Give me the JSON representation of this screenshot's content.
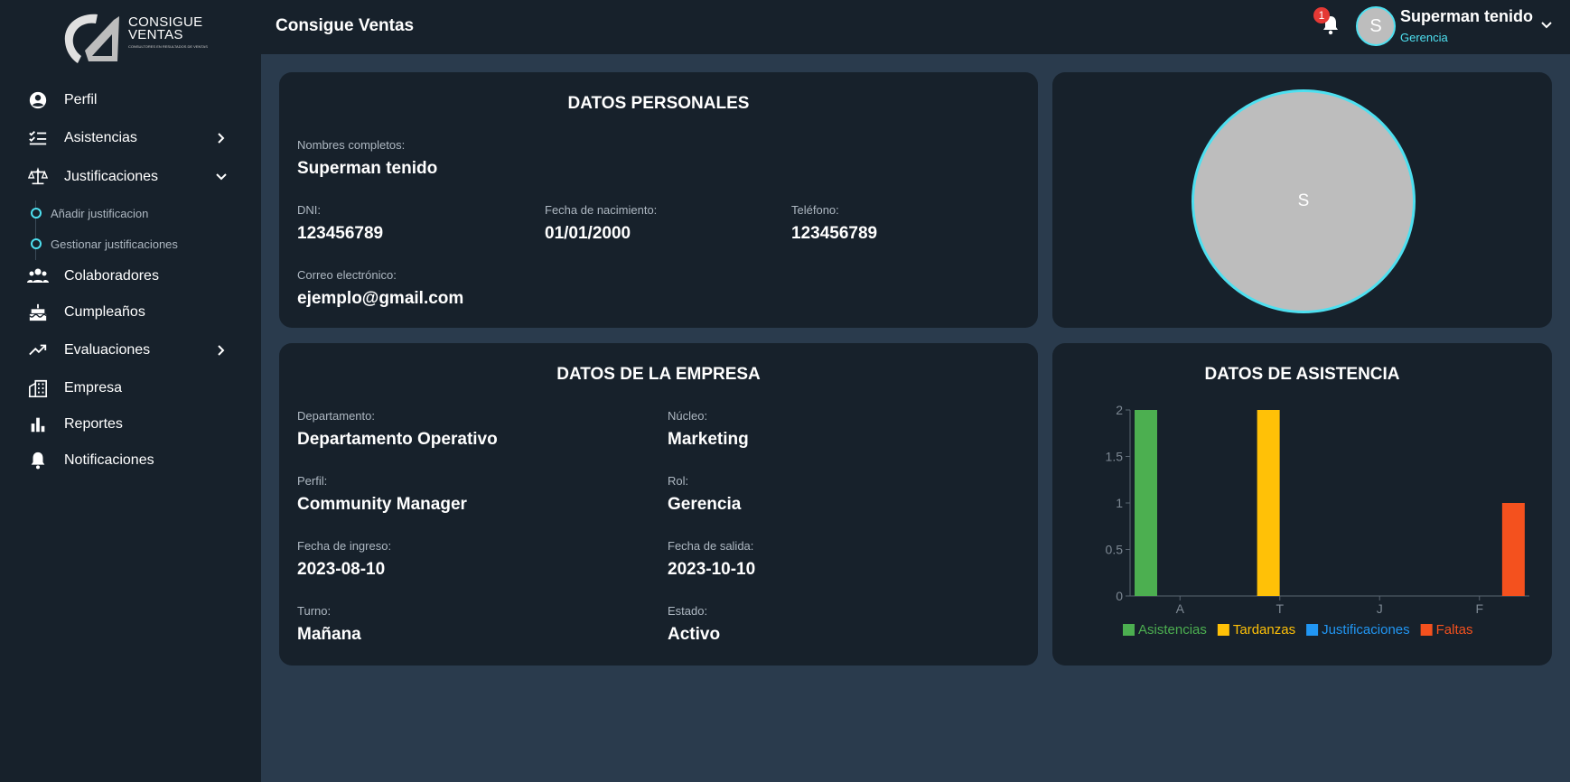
{
  "brand": {
    "logo_line1": "CONSIGUE",
    "logo_line2": "VENTAS",
    "logo_sub": "CONSULTORES EN RESULTADOS DE VENTAS"
  },
  "app_title": "Consigue Ventas",
  "notifications": {
    "count": "1"
  },
  "user": {
    "initial": "S",
    "name": "Superman tenido",
    "role": "Gerencia"
  },
  "sidebar": {
    "items": [
      {
        "label": "Perfil",
        "icon": "user-circle-icon"
      },
      {
        "label": "Asistencias",
        "icon": "checklist-icon"
      },
      {
        "label": "Justificaciones",
        "icon": "scale-icon"
      },
      {
        "label": "Colaboradores",
        "icon": "people-icon"
      },
      {
        "label": "Cumpleaños",
        "icon": "cake-icon"
      },
      {
        "label": "Evaluaciones",
        "icon": "trending-up-icon"
      },
      {
        "label": "Empresa",
        "icon": "building-icon"
      },
      {
        "label": "Reportes",
        "icon": "bar-chart-icon"
      },
      {
        "label": "Notificaciones",
        "icon": "bell-icon"
      }
    ],
    "sub_items": [
      {
        "label": "Añadir justificacion"
      },
      {
        "label": "Gestionar justificaciones"
      }
    ]
  },
  "personal": {
    "title": "DATOS PERSONALES",
    "fullname_label": "Nombres completos:",
    "fullname": "Superman tenido",
    "dni_label": "DNI:",
    "dni": "123456789",
    "birth_label": "Fecha de nacimiento:",
    "birth": "01/01/2000",
    "phone_label": "Teléfono:",
    "phone": "123456789",
    "email_label": "Correo electrónico:",
    "email": "ejemplo@gmail.com"
  },
  "profile_photo": {
    "initial": "S"
  },
  "company": {
    "title": "DATOS DE LA EMPRESA",
    "dept_label": "Departamento:",
    "dept": "Departamento Operativo",
    "nucleo_label": "Núcleo:",
    "nucleo": "Marketing",
    "perfil_label": "Perfil:",
    "perfil": "Community Manager",
    "rol_label": "Rol:",
    "rol": "Gerencia",
    "ingreso_label": "Fecha de ingreso:",
    "ingreso": "2023-08-10",
    "salida_label": "Fecha de salida:",
    "salida": "2023-10-10",
    "turno_label": "Turno:",
    "turno": "Mañana",
    "estado_label": "Estado:",
    "estado": "Activo"
  },
  "attendance": {
    "title": "DATOS DE ASISTENCIA"
  },
  "chart_data": {
    "type": "bar",
    "categories": [
      "A",
      "T",
      "J",
      "F"
    ],
    "series": [
      {
        "name": "Asistencias",
        "color": "#4caf50",
        "values": [
          2,
          0,
          0,
          0
        ]
      },
      {
        "name": "Tardanzas",
        "color": "#ffc107",
        "values": [
          0,
          2,
          0,
          0
        ]
      },
      {
        "name": "Justificaciones",
        "color": "#2196f3",
        "values": [
          0,
          0,
          0,
          0
        ]
      },
      {
        "name": "Faltas",
        "color": "#f4511e",
        "values": [
          0,
          0,
          0,
          1
        ]
      }
    ],
    "yticks": [
      "0",
      "0.5",
      "1",
      "1.5",
      "2"
    ],
    "ylim": [
      0,
      2
    ],
    "legend": "bottom",
    "grid": false
  }
}
